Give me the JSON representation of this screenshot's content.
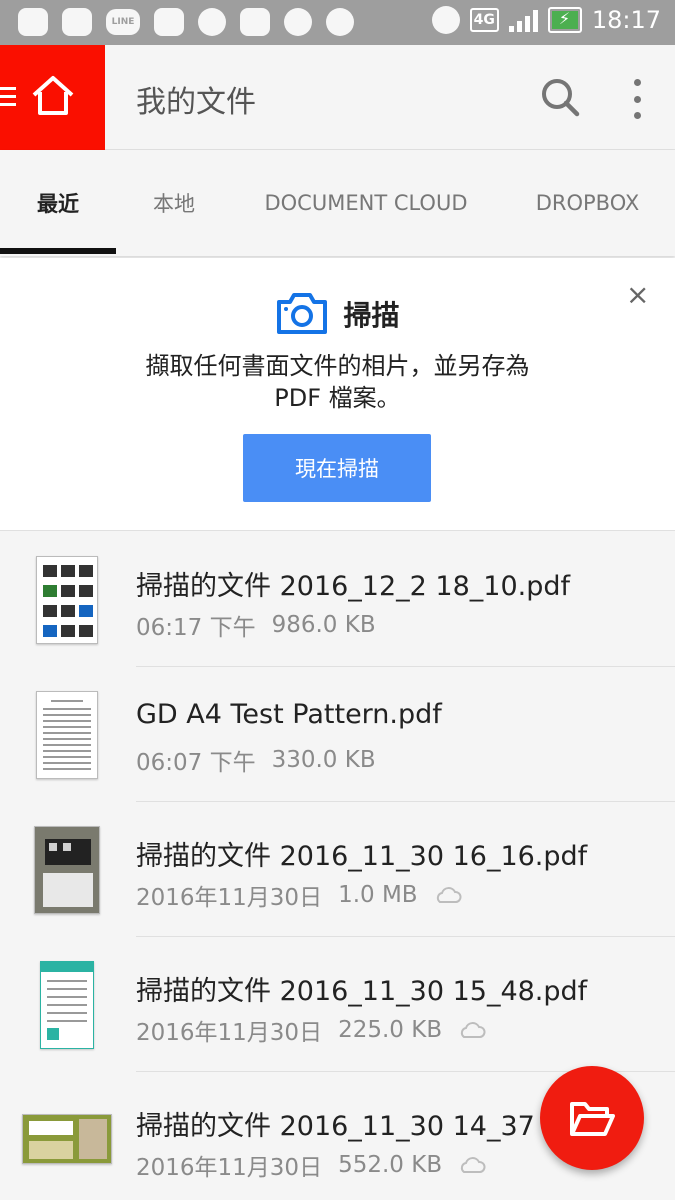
{
  "status_bar": {
    "network": "4G",
    "time": "18:17",
    "line_badge": "LINE"
  },
  "app_bar": {
    "title": "我的文件"
  },
  "tabs": [
    {
      "label": "最近",
      "active": true
    },
    {
      "label": "本地",
      "active": false
    },
    {
      "label": "DOCUMENT CLOUD",
      "active": false
    },
    {
      "label": "DROPBOX",
      "active": false
    }
  ],
  "promo": {
    "title": "掃描",
    "description": "擷取任何書面文件的相片，並另存為 PDF 檔案。",
    "button_label": "現在掃描",
    "close_label": "×"
  },
  "files": [
    {
      "name": "掃描的文件 2016_12_2 18_10.pdf",
      "time": "06:17 下午",
      "size": "986.0 KB",
      "cloud": false
    },
    {
      "name": "GD A4 Test Pattern.pdf",
      "time": "06:07 下午",
      "size": "330.0 KB",
      "cloud": false
    },
    {
      "name": "掃描的文件 2016_11_30 16_16.pdf",
      "time": "2016年11月30日",
      "size": "1.0 MB",
      "cloud": true
    },
    {
      "name": "掃描的文件 2016_11_30 15_48.pdf",
      "time": "2016年11月30日",
      "size": "225.0 KB",
      "cloud": true
    },
    {
      "name": "掃描的文件 2016_11_30 14_37",
      "time": "2016年11月30日",
      "size": "552.0 KB",
      "cloud": true
    }
  ],
  "colors": {
    "brand_red": "#fa0f00",
    "button_blue": "#4a8ef5",
    "fab_red": "#f01c10"
  },
  "icons": [
    "menu-icon",
    "home-icon",
    "search-icon",
    "more-icon",
    "camera-icon",
    "close-icon",
    "cloud-icon",
    "folder-open-icon"
  ]
}
